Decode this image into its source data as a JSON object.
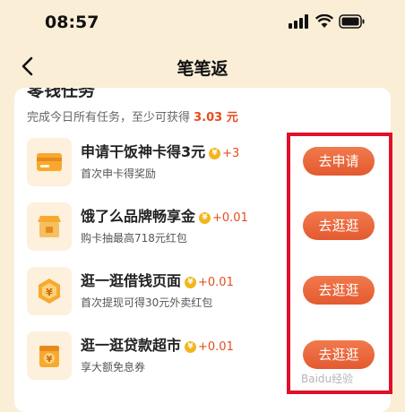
{
  "status": {
    "time": "08:57"
  },
  "nav": {
    "title": "笔笔返"
  },
  "section": {
    "title": "零钱任务",
    "summary_prefix": "完成今日所有任务，至少可获得",
    "summary_amount": "3.03 元"
  },
  "tasks": [
    {
      "title": "申请干饭神卡得3元",
      "reward": "+3",
      "sub": "首次申卡得奖励",
      "button": "去申请",
      "icon": "card-icon"
    },
    {
      "title": "饿了么品牌畅享金",
      "reward": "+0.01",
      "sub": "购卡抽最高718元红包",
      "button": "去逛逛",
      "icon": "store-icon"
    },
    {
      "title": "逛一逛借钱页面",
      "reward": "+0.01",
      "sub": "首次提现可得30元外卖红包",
      "button": "去逛逛",
      "icon": "yen-badge-icon"
    },
    {
      "title": "逛一逛贷款超市",
      "reward": "+0.01",
      "sub": "享大额免息券",
      "button": "去逛逛",
      "icon": "yen-bag-icon"
    }
  ],
  "coin_symbol": "¥",
  "watermark": "Baidu经验",
  "colors": {
    "accent": "#e84c1e",
    "button": "#e45a30",
    "highlight": "#e0102a",
    "background": "#fbeed7"
  }
}
